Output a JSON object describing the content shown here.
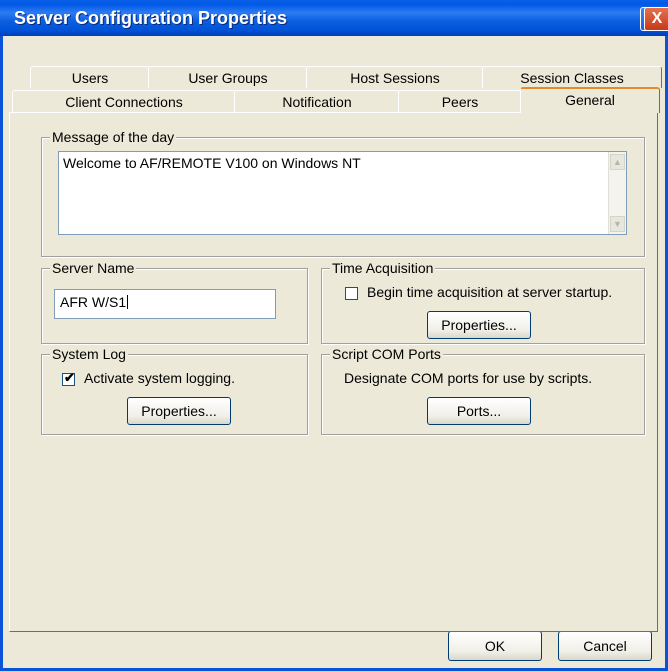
{
  "window": {
    "title": "Server Configuration Properties",
    "help_glyph": "?",
    "close_glyph": "X"
  },
  "tabs": {
    "row1": [
      "Users",
      "User Groups",
      "Host Sessions",
      "Session Classes"
    ],
    "row2": [
      "Client Connections",
      "Notification",
      "Peers",
      "General"
    ],
    "selected": "General"
  },
  "motd": {
    "title": "Message of the day",
    "text": "Welcome to AF/REMOTE V100 on Windows NT"
  },
  "server_name": {
    "title": "Server Name",
    "value": "AFR W/S1"
  },
  "time_acquisition": {
    "title": "Time Acquisition",
    "checkbox_label": "Begin time acquisition at server startup.",
    "checked": false,
    "button": "Properties..."
  },
  "system_log": {
    "title": "System Log",
    "checkbox_label": "Activate system logging.",
    "checked": true,
    "button": "Properties..."
  },
  "script_com": {
    "title": "Script COM Ports",
    "description": "Designate COM ports for use by scripts.",
    "button": "Ports..."
  },
  "footer": {
    "ok": "OK",
    "cancel": "Cancel"
  },
  "colors": {
    "title_bar": "#0058E6",
    "dialog_bg": "#ECE9D8",
    "close_button": "#C33A1A"
  }
}
